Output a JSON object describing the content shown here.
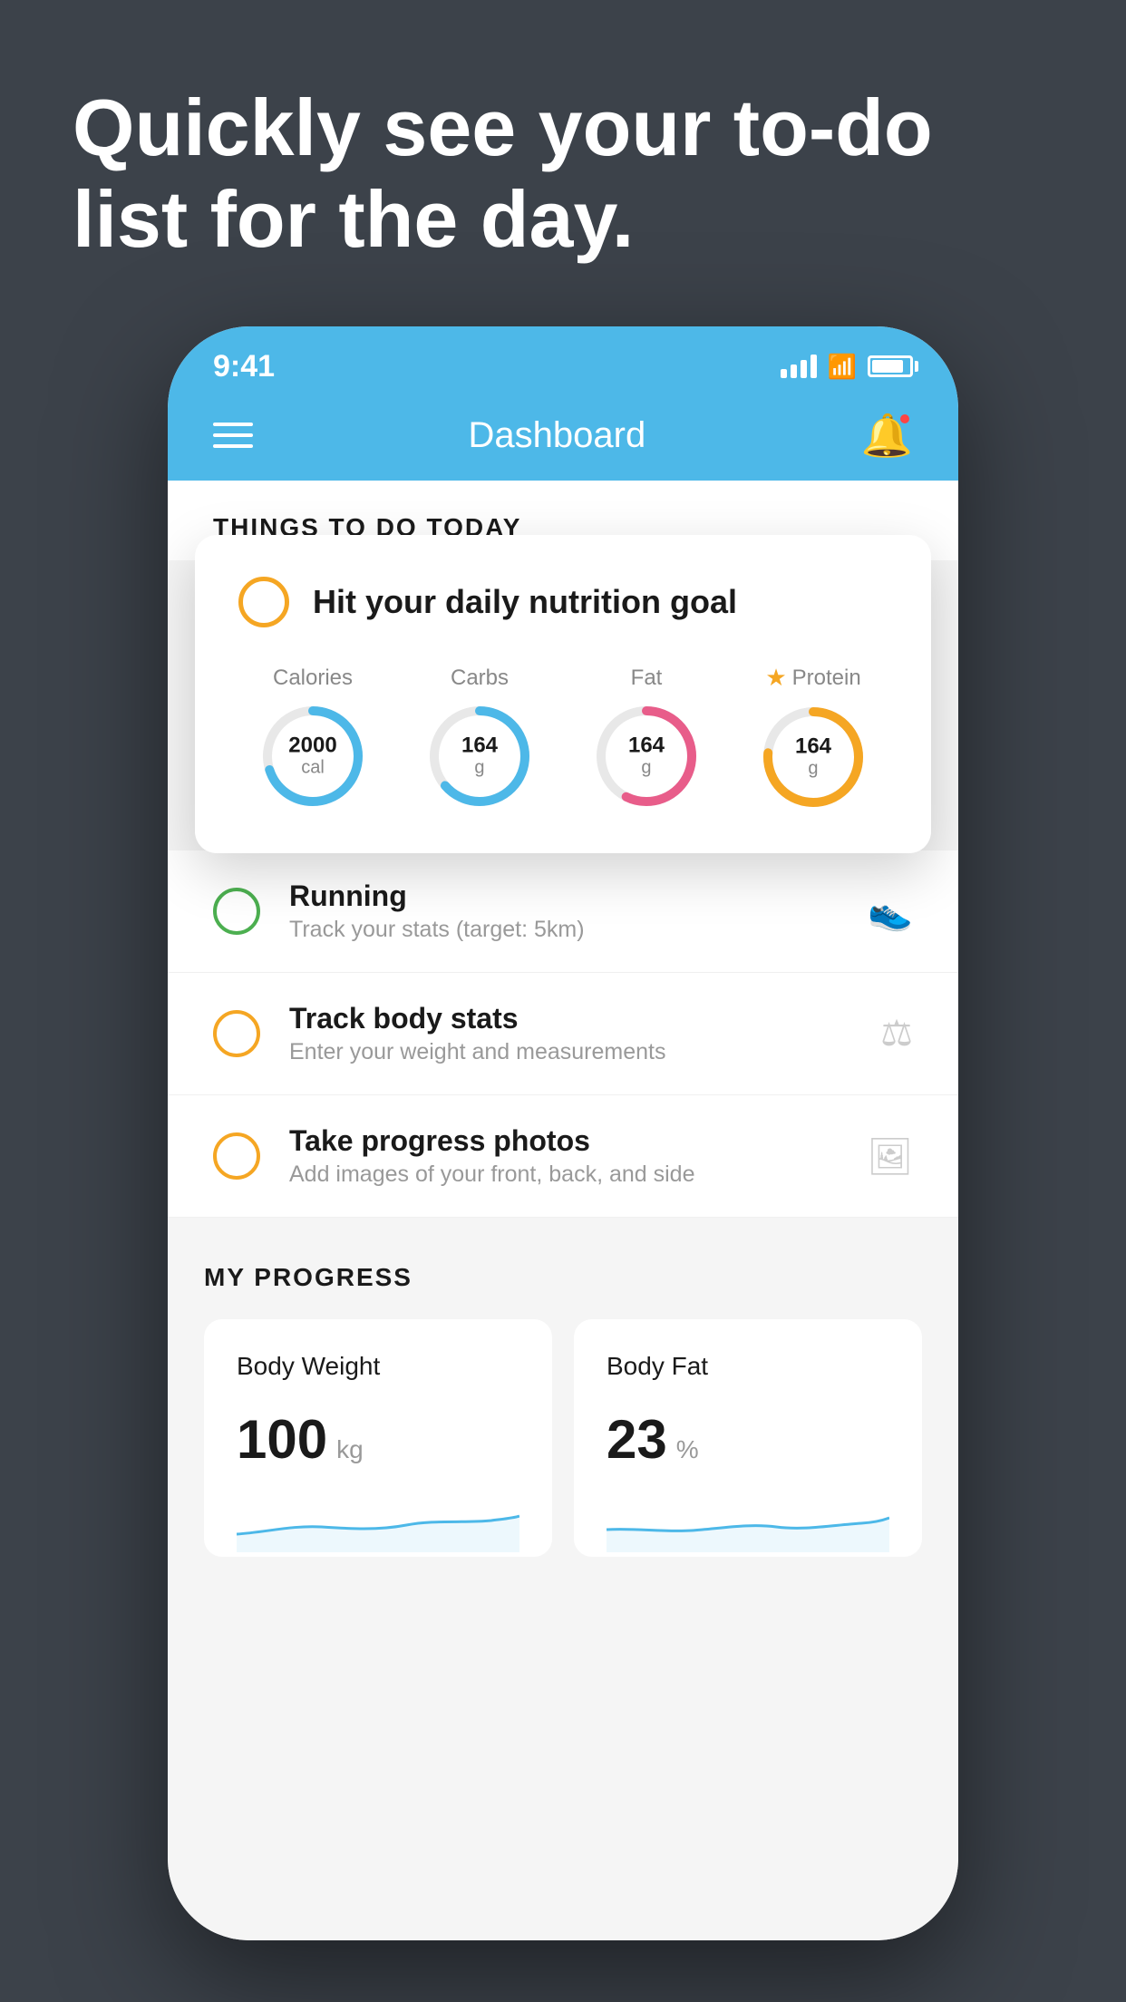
{
  "background": {
    "color": "#3c424a"
  },
  "hero": {
    "title": "Quickly see your to-do list for the day."
  },
  "phone": {
    "statusBar": {
      "time": "9:41"
    },
    "navBar": {
      "title": "Dashboard"
    },
    "sectionHeader": {
      "title": "THINGS TO DO TODAY"
    },
    "floatingCard": {
      "checkLabel": "Hit your daily nutrition goal",
      "nutrients": [
        {
          "label": "Calories",
          "value": "2000",
          "unit": "cal",
          "color": "blue"
        },
        {
          "label": "Carbs",
          "value": "164",
          "unit": "g",
          "color": "blue"
        },
        {
          "label": "Fat",
          "value": "164",
          "unit": "g",
          "color": "pink"
        },
        {
          "label": "Protein",
          "value": "164",
          "unit": "g",
          "color": "gold",
          "star": true
        }
      ]
    },
    "todoItems": [
      {
        "name": "Running",
        "desc": "Track your stats (target: 5km)",
        "circleColor": "green",
        "icon": "👟"
      },
      {
        "name": "Track body stats",
        "desc": "Enter your weight and measurements",
        "circleColor": "yellow",
        "icon": "⚖"
      },
      {
        "name": "Take progress photos",
        "desc": "Add images of your front, back, and side",
        "circleColor": "yellow",
        "icon": "🖼"
      }
    ],
    "progressSection": {
      "title": "MY PROGRESS",
      "cards": [
        {
          "title": "Body Weight",
          "value": "100",
          "unit": "kg"
        },
        {
          "title": "Body Fat",
          "value": "23",
          "unit": "%"
        }
      ]
    }
  }
}
